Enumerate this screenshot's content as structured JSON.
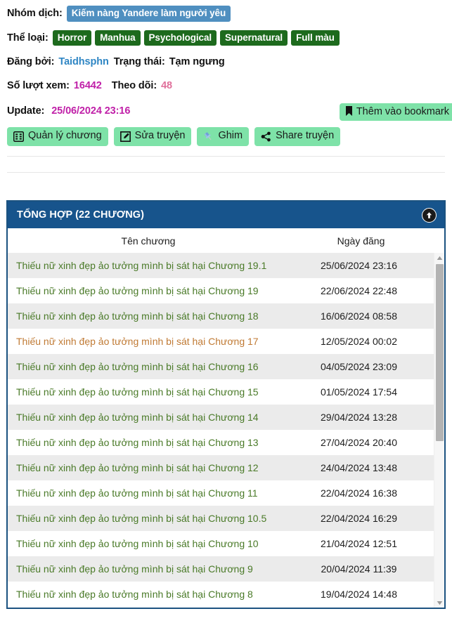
{
  "info": {
    "team_label": "Nhóm dịch:",
    "team_name": "Kiếm nàng Yandere làm người yêu",
    "genre_label": "Thể loại:",
    "genres": [
      "Horror",
      "Manhua",
      "Psychological",
      "Supernatural",
      "Full màu"
    ],
    "poster_label": "Đăng bởi:",
    "poster_name": "Taidhsphn",
    "status_label": "Trạng thái:",
    "status_value": "Tạm ngưng",
    "views_label": "Số lượt xem:",
    "views_value": "16442",
    "follows_label": "Theo dõi:",
    "follows_value": "48",
    "update_label": "Update:",
    "update_value": "25/06/2024 23:16"
  },
  "bookmark_button": {
    "label": "Thêm vào bookmark",
    "icon": "bookmark-icon"
  },
  "actions": [
    {
      "label": "Quản lý chương",
      "icon": "table-grid-icon"
    },
    {
      "label": "Sửa truyện",
      "icon": "pencil-square-icon"
    },
    {
      "label": "Ghim",
      "icon": "pushpin-icon"
    },
    {
      "label": "Share truyện",
      "icon": "share-nodes-icon"
    }
  ],
  "panel": {
    "title": "TỔNG HỢP (22 CHƯƠNG)",
    "scroll_top_icon": "arrow-up-circle-icon",
    "columns": [
      "Tên chương",
      "Ngày đăng"
    ],
    "chapters": [
      {
        "name": "Thiếu nữ xinh đẹp ảo tưởng mình bị sát hại Chương 19.1",
        "date": "25/06/2024 23:16",
        "read": false
      },
      {
        "name": "Thiếu nữ xinh đẹp ảo tưởng mình bị sát hại Chương 19",
        "date": "22/06/2024 22:48",
        "read": false
      },
      {
        "name": "Thiếu nữ xinh đẹp ảo tưởng mình bị sát hại Chương 18",
        "date": "16/06/2024 08:58",
        "read": false
      },
      {
        "name": "Thiếu nữ xinh đẹp ảo tưởng mình bị sát hại Chương 17",
        "date": "12/05/2024 00:02",
        "read": true
      },
      {
        "name": "Thiếu nữ xinh đẹp ảo tưởng mình bị sát hại Chương 16",
        "date": "04/05/2024 23:09",
        "read": false
      },
      {
        "name": "Thiếu nữ xinh đẹp ảo tưởng mình bị sát hại Chương 15",
        "date": "01/05/2024 17:54",
        "read": false
      },
      {
        "name": "Thiếu nữ xinh đẹp ảo tưởng mình bị sát hại Chương 14",
        "date": "29/04/2024 13:28",
        "read": false
      },
      {
        "name": "Thiếu nữ xinh đẹp ảo tưởng mình bị sát hại Chương 13",
        "date": "27/04/2024 20:40",
        "read": false
      },
      {
        "name": "Thiếu nữ xinh đẹp ảo tưởng mình bị sát hại Chương 12",
        "date": "24/04/2024 13:48",
        "read": false
      },
      {
        "name": "Thiếu nữ xinh đẹp ảo tưởng mình bị sát hại Chương 11",
        "date": "22/04/2024 16:38",
        "read": false
      },
      {
        "name": "Thiếu nữ xinh đẹp ảo tưởng mình bị sát hại Chương 10.5",
        "date": "22/04/2024 16:29",
        "read": false
      },
      {
        "name": "Thiếu nữ xinh đẹp ảo tưởng mình bị sát hại Chương 10",
        "date": "21/04/2024 12:51",
        "read": false
      },
      {
        "name": "Thiếu nữ xinh đẹp ảo tưởng mình bị sát hại Chương 9",
        "date": "20/04/2024 11:39",
        "read": false
      },
      {
        "name": "Thiếu nữ xinh đẹp ảo tưởng mình bị sát hại Chương 8",
        "date": "19/04/2024 14:48",
        "read": false
      }
    ]
  },
  "colors": {
    "panel_header": "#17548c",
    "panel_border": "#1b5280",
    "genre_tag": "#1d6a1d",
    "team_tag": "#4f8fc0",
    "button_green": "#7ee2a8",
    "chapter_link": "#4a7a28",
    "chapter_link_read": "#c07a34",
    "views": "#c020a8",
    "follows": "#e0709b"
  }
}
